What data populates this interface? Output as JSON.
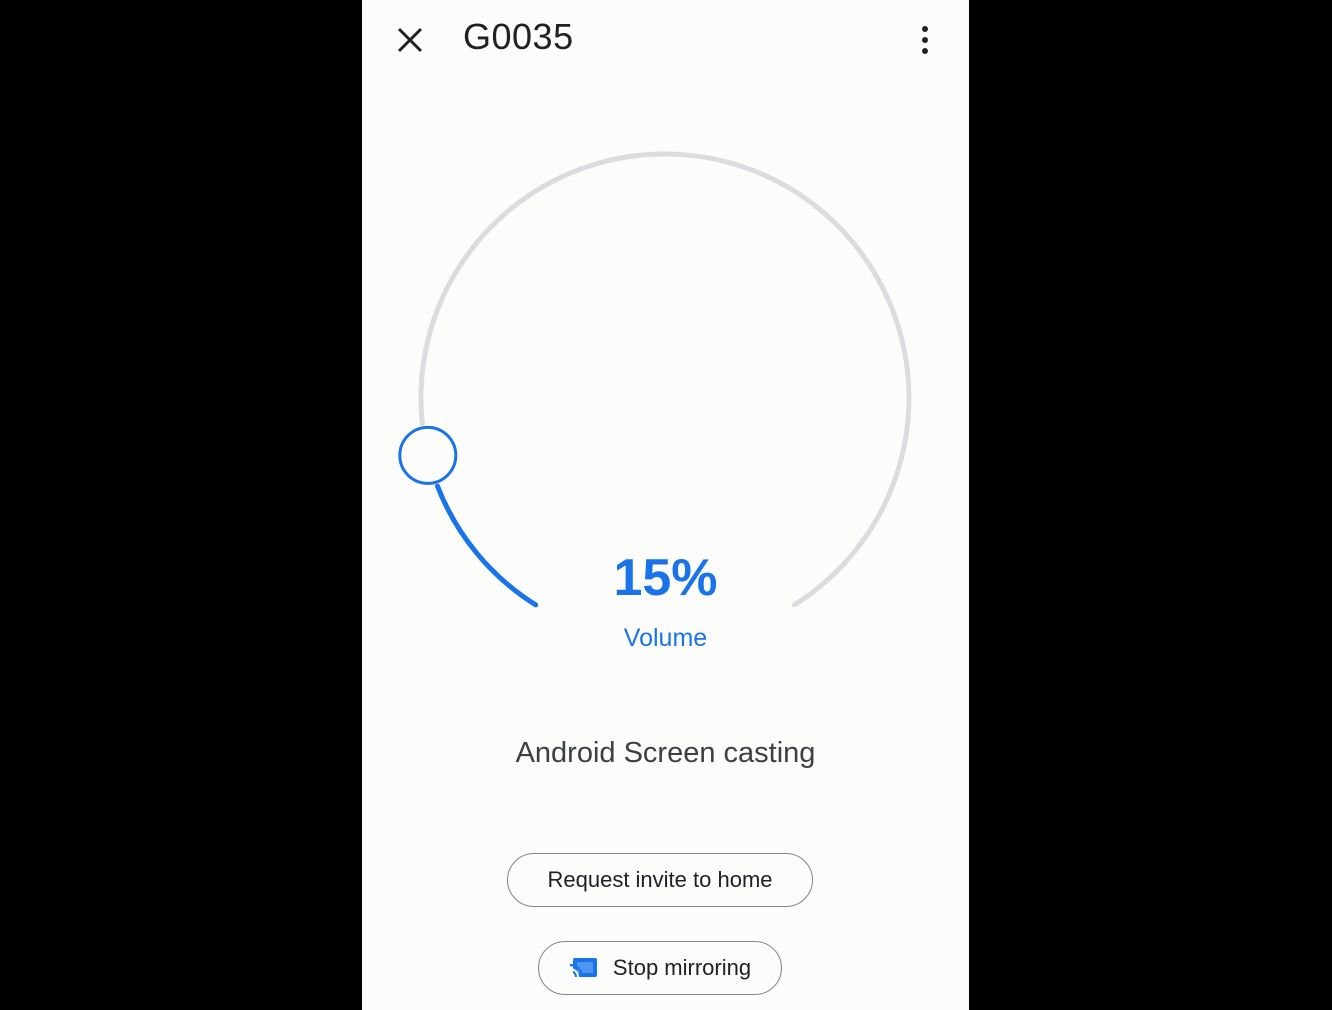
{
  "header": {
    "title": "G0035",
    "close_icon": "close-icon",
    "more_icon": "more-vert-icon"
  },
  "volume": {
    "percent_text": "15%",
    "label": "Volume",
    "level": 0.15
  },
  "status": {
    "text": "Android Screen casting"
  },
  "actions": {
    "request_invite_label": "Request invite to home",
    "stop_mirroring_label": "Stop mirroring",
    "stop_mirroring_icon": "cast-connected-icon"
  },
  "colors": {
    "accent": "#1a73e8",
    "track": "#dadce0",
    "background": "#fcfdfa"
  }
}
